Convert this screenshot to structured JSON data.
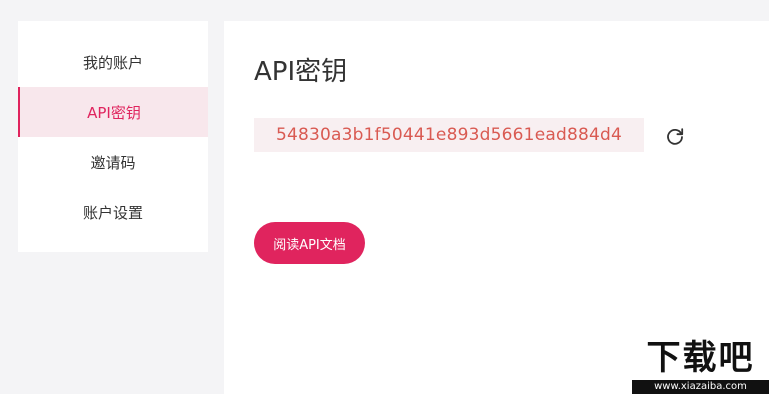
{
  "sidebar": {
    "items": [
      {
        "label": "我的账户",
        "active": false
      },
      {
        "label": "API密钥",
        "active": true
      },
      {
        "label": "邀请码",
        "active": false
      },
      {
        "label": "账户设置",
        "active": false
      }
    ]
  },
  "main": {
    "title": "API密钥",
    "api_key": "54830a3b1f50441e893d5661ead884d4",
    "refresh_icon": "refresh-icon",
    "doc_button_label": "阅读API文档"
  },
  "watermark": {
    "logo_text": "下载吧",
    "url": "www.xiazaiba.com"
  },
  "colors": {
    "accent": "#e0245e",
    "key_text": "#d95a52",
    "key_bg": "#f8eff1",
    "active_bg": "#f8e7ec"
  }
}
